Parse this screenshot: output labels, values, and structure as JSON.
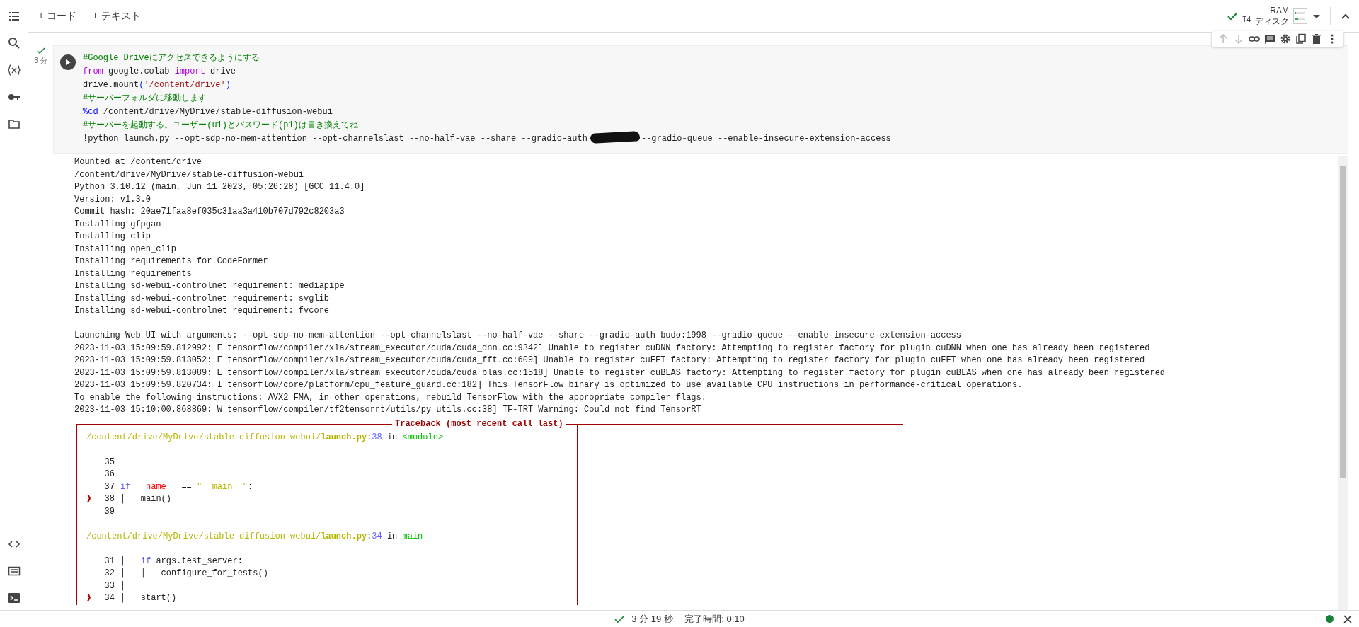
{
  "toolbar": {
    "buttons": [
      {
        "label": "+ コード"
      },
      {
        "label": "+ テキスト"
      }
    ]
  },
  "runtime": {
    "connected": true,
    "gpu": "T4",
    "meters": [
      {
        "label": "RAM",
        "level": 0.05
      },
      {
        "label": "ディスク",
        "level": 0.3
      }
    ]
  },
  "cell": {
    "status": {
      "done": true,
      "elapsed": "3 分"
    },
    "code": [
      [
        {
          "text": "#Google Driveにアクセスできるようにする",
          "kind": "comment"
        }
      ],
      [
        {
          "text": "from",
          "kind": "keyword"
        },
        {
          "text": " google.colab ",
          "kind": "plain"
        },
        {
          "text": "import",
          "kind": "keyword"
        },
        {
          "text": " drive",
          "kind": "plain"
        }
      ],
      [
        {
          "text": "drive.mount",
          "kind": "plain"
        },
        {
          "text": "(",
          "kind": "bracket"
        },
        {
          "text": "'/content/drive'",
          "kind": "string"
        },
        {
          "text": ")",
          "kind": "bracket"
        }
      ],
      [
        {
          "text": "#サーバーフォルダに移動します",
          "kind": "comment"
        }
      ],
      [
        {
          "text": "%cd ",
          "kind": "magic"
        },
        {
          "text": "/content/drive/MyDrive/stable-diffusion-webui",
          "kind": "path"
        }
      ],
      [
        {
          "text": "#サーバーを起動する。ユーザー(u1)とパスワード(p1)は書き換えてね",
          "kind": "comment"
        }
      ],
      [
        {
          "text": "!python launch.py --opt-sdp-no-mem-attention --opt-channelslast --no-half-vae --share --gradio-auth",
          "kind": "plain"
        },
        {
          "kind": "redacted"
        },
        {
          "text": "--gradio-queue --enable-insecure-extension-access",
          "kind": "plain"
        }
      ]
    ],
    "output": {
      "lines": [
        "Mounted at /content/drive",
        "/content/drive/MyDrive/stable-diffusion-webui",
        "Python 3.10.12 (main, Jun 11 2023, 05:26:28) [GCC 11.4.0]",
        "Version: v1.3.0",
        "Commit hash: 20ae71faa8ef035c31aa3a410b707d792c8203a3",
        "Installing gfpgan",
        "Installing clip",
        "Installing open_clip",
        "Installing requirements for CodeFormer",
        "Installing requirements",
        "Installing sd-webui-controlnet requirement: mediapipe",
        "Installing sd-webui-controlnet requirement: svglib",
        "Installing sd-webui-controlnet requirement: fvcore",
        "Launching Web UI with arguments: --opt-sdp-no-mem-attention --opt-channelslast --no-half-vae --share --gradio-auth budo:1998 --gradio-queue --enable-insecure-extension-access",
        "2023-11-03 15:09:59.812992: E tensorflow/compiler/xla/stream_executor/cuda/cuda_dnn.cc:9342] Unable to register cuDNN factory: Attempting to register factory for plugin cuDNN when one has already been registered",
        "2023-11-03 15:09:59.813052: E tensorflow/compiler/xla/stream_executor/cuda/cuda_fft.cc:609] Unable to register cuFFT factory: Attempting to register factory for plugin cuFFT when one has already been registered",
        "2023-11-03 15:09:59.813089: E tensorflow/compiler/xla/stream_executor/cuda/cuda_blas.cc:1518] Unable to register cuBLAS factory: Attempting to register factory for plugin cuBLAS when one has already been registered",
        "2023-11-03 15:09:59.820734: I tensorflow/core/platform/cpu_feature_guard.cc:182] This TensorFlow binary is optimized to use available CPU instructions in performance-critical operations.",
        "To enable the following instructions: AVX2 FMA, in other operations, rebuild TensorFlow with the appropriate compiler flags.",
        "2023-11-03 15:10:00.868869: W tensorflow/compiler/tf2tensorrt/utils/py_utils.cc:38] TF-TRT Warning: Could not find TensorRT"
      ],
      "traceback": {
        "title": "Traceback (most recent call last)",
        "frames": [
          {
            "location": [
              {
                "text": "/content/drive/MyDrive/stable-diffusion-webui/",
                "kind": "tb-path"
              },
              {
                "text": "launch.py",
                "kind": "tb-file"
              },
              {
                "text": ":",
                "kind": "plain"
              },
              {
                "text": "38",
                "kind": "tb-lineno"
              },
              {
                "text": " in ",
                "kind": "plain"
              },
              {
                "text": "<module>",
                "kind": "tb-func"
              }
            ],
            "lines": [
              {
                "number": "35"
              },
              {
                "number": "36"
              },
              {
                "number": "37",
                "code": [
                  {
                    "text": "if ",
                    "kind": "tb-keyword"
                  },
                  {
                    "text": "__name__",
                    "kind": "tb-name"
                  },
                  {
                    "text": " == ",
                    "kind": "plain"
                  },
                  {
                    "text": "\"__main__\"",
                    "kind": "tb-string"
                  },
                  {
                    "text": ":",
                    "kind": "plain"
                  }
                ]
              },
              {
                "number": "38",
                "marker": "❱",
                "code": [
                  {
                    "text": "│   main()",
                    "kind": "plain"
                  }
                ]
              },
              {
                "number": "39"
              }
            ]
          },
          {
            "location": [
              {
                "text": "/content/drive/MyDrive/stable-diffusion-webui/",
                "kind": "tb-path"
              },
              {
                "text": "launch.py",
                "kind": "tb-file"
              },
              {
                "text": ":",
                "kind": "plain"
              },
              {
                "text": "34",
                "kind": "tb-lineno"
              },
              {
                "text": " in ",
                "kind": "plain"
              },
              {
                "text": "main",
                "kind": "tb-func"
              }
            ],
            "lines": [
              {
                "number": "31",
                "code": [
                  {
                    "text": "│   ",
                    "kind": "plain"
                  },
                  {
                    "text": "if",
                    "kind": "tb-keyword"
                  },
                  {
                    "text": " args.test_server:",
                    "kind": "plain"
                  }
                ]
              },
              {
                "number": "32",
                "code": [
                  {
                    "text": "│   │   configure_for_tests()",
                    "kind": "plain"
                  }
                ]
              },
              {
                "number": "33",
                "code": [
                  {
                    "text": "│",
                    "kind": "plain"
                  }
                ]
              },
              {
                "number": "34",
                "marker": "❱",
                "code": [
                  {
                    "text": "│   start()",
                    "kind": "plain"
                  }
                ]
              }
            ]
          }
        ]
      }
    }
  },
  "status_bar": {
    "done": true,
    "elapsed": "3 分 19 秒",
    "completed": "完了時間: 0:10",
    "connected": true
  }
}
